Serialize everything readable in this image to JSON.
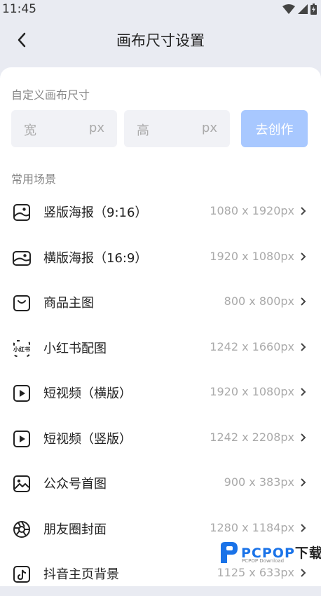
{
  "status": {
    "time": "11:45"
  },
  "header": {
    "title": "画布尺寸设置"
  },
  "custom": {
    "label": "自定义画布尺寸",
    "width_placeholder": "宽",
    "height_placeholder": "高",
    "unit": "px",
    "create_label": "去创作"
  },
  "scenes": {
    "label": "常用场景",
    "items": [
      {
        "name": "竖版海报（9:16）",
        "size": "1080 x 1920px",
        "icon": "poster-portrait-icon"
      },
      {
        "name": "横版海报（16:9）",
        "size": "1920 x 1080px",
        "icon": "poster-landscape-icon"
      },
      {
        "name": "商品主图",
        "size": "800 x 800px",
        "icon": "shopping-bag-icon"
      },
      {
        "name": "小红书配图",
        "size": "1242 x 1660px",
        "icon": "xiaohongshu-icon"
      },
      {
        "name": "短视频（横版）",
        "size": "1920 x 1080px",
        "icon": "play-icon"
      },
      {
        "name": "短视频（竖版）",
        "size": "1242 x 2208px",
        "icon": "play-icon"
      },
      {
        "name": "公众号首图",
        "size": "900 x 383px",
        "icon": "image-icon"
      },
      {
        "name": "朋友圈封面",
        "size": "1280 x 1184px",
        "icon": "aperture-icon"
      },
      {
        "name": "抖音主页背景",
        "size": "1125 x 633px",
        "icon": "tiktok-icon"
      }
    ]
  },
  "watermark": {
    "brand": "PCPOP",
    "brand_cn": "下载",
    "sub": "PCPOP Download"
  },
  "colors": {
    "accent_disabled": "#a8c8ff",
    "panel_bg": "#ffffff",
    "page_bg": "#e9ebf2"
  }
}
